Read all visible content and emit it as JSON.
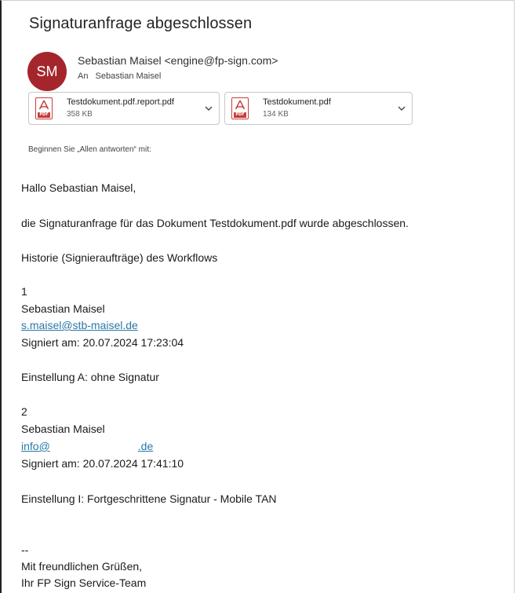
{
  "email": {
    "subject": "Signaturanfrage abgeschlossen",
    "avatar_initials": "SM",
    "avatar_color": "#a4262c",
    "sender": "Sebastian Maisel <engine@fp-sign.com>",
    "to_label": "An",
    "to_name": "Sebastian Maisel"
  },
  "attachments": [
    {
      "name": "Testdokument.pdf.report.pdf",
      "size": "358 KB",
      "icon": "pdf-icon"
    },
    {
      "name": "Testdokument.pdf",
      "size": "134 KB",
      "icon": "pdf-icon"
    }
  ],
  "reply_hint": "Beginnen Sie „Allen antworten“ mit:",
  "body": {
    "greeting": "Hallo Sebastian Maisel,",
    "intro": "die Signaturanfrage für das Dokument Testdokument.pdf wurde abgeschlossen.",
    "history_heading": "Historie (Signieraufträge) des Workflows",
    "entries": [
      {
        "number": "1",
        "name": "Sebastian Maisel",
        "email": "s.maisel@stb-maisel.de",
        "signed": "Signiert am: 20.07.2024 17:23:04",
        "setting": "Einstellung A: ohne Signatur"
      },
      {
        "number": "2",
        "name": "Sebastian Maisel",
        "email_prefix": "info@",
        "email_suffix": ".de",
        "signed": "Signiert am: 20.07.2024 17:41:10",
        "setting": "Einstellung I: Fortgeschrittene Signatur - Mobile TAN"
      }
    ],
    "separator": "--",
    "closing": "Mit freundlichen Grüßen,",
    "signature": "Ihr FP Sign Service-Team"
  }
}
